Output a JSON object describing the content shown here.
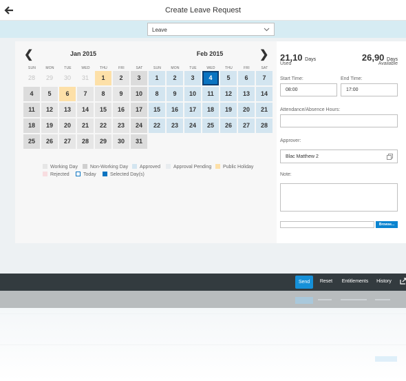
{
  "header": {
    "title": "Create Leave Request"
  },
  "leave_type": {
    "selected": "Leave"
  },
  "calendar": {
    "dow": [
      "SUN",
      "MON",
      "TUE",
      "WED",
      "THU",
      "FRI",
      "SAT"
    ],
    "jan": {
      "title": "Jan 2015",
      "weeks": [
        [
          "28",
          "29",
          "30",
          "31",
          "1",
          "2",
          "3"
        ],
        [
          "4",
          "5",
          "6",
          "7",
          "8",
          "9",
          "10"
        ],
        [
          "11",
          "12",
          "13",
          "14",
          "15",
          "16",
          "17"
        ],
        [
          "18",
          "19",
          "20",
          "21",
          "22",
          "23",
          "24"
        ],
        [
          "25",
          "26",
          "27",
          "28",
          "29",
          "30",
          "31"
        ]
      ]
    },
    "feb": {
      "title": "Feb 2015",
      "weeks": [
        [
          "1",
          "2",
          "3",
          "4",
          "5",
          "6",
          "7"
        ],
        [
          "8",
          "9",
          "10",
          "11",
          "12",
          "13",
          "14"
        ],
        [
          "15",
          "16",
          "17",
          "18",
          "19",
          "20",
          "21"
        ],
        [
          "22",
          "23",
          "24",
          "25",
          "26",
          "27",
          "28"
        ]
      ]
    },
    "prev_glyph": "❮",
    "next_glyph": "❯"
  },
  "legend": {
    "working_day": "Working Day",
    "non_working_day": "Non-Working Day",
    "approved": "Approved",
    "approval_pending": "Approval Pending",
    "public_holiday": "Public Holiday",
    "rejected": "Rejected",
    "today": "Today",
    "selected": "Selected Day(s)"
  },
  "balances": {
    "used_value": "21,10",
    "used_unit": "Days",
    "used_label": "Used",
    "available_value": "26,90",
    "available_unit": "Days",
    "available_label": "Available"
  },
  "form": {
    "start_time_label": "Start Time:",
    "start_time_value": "08:00",
    "end_time_label": "End Time:",
    "end_time_value": "17:00",
    "hours_label": "Attendance/Absence Hours:",
    "hours_value": "",
    "approver_label": "Approver:",
    "approver_value": "Blac Matthew 2",
    "note_label": "Note:",
    "note_value": "",
    "file_value": "",
    "browse_label": "Browse..."
  },
  "footer": {
    "send": "Send",
    "reset": "Reset",
    "entitlements": "Entitlements",
    "history": "History"
  },
  "colors": {
    "accent": "#0b74c1",
    "footer_bg": "#333b3f",
    "holiday": "#fde0a8",
    "approved": "#d3e5f0"
  }
}
